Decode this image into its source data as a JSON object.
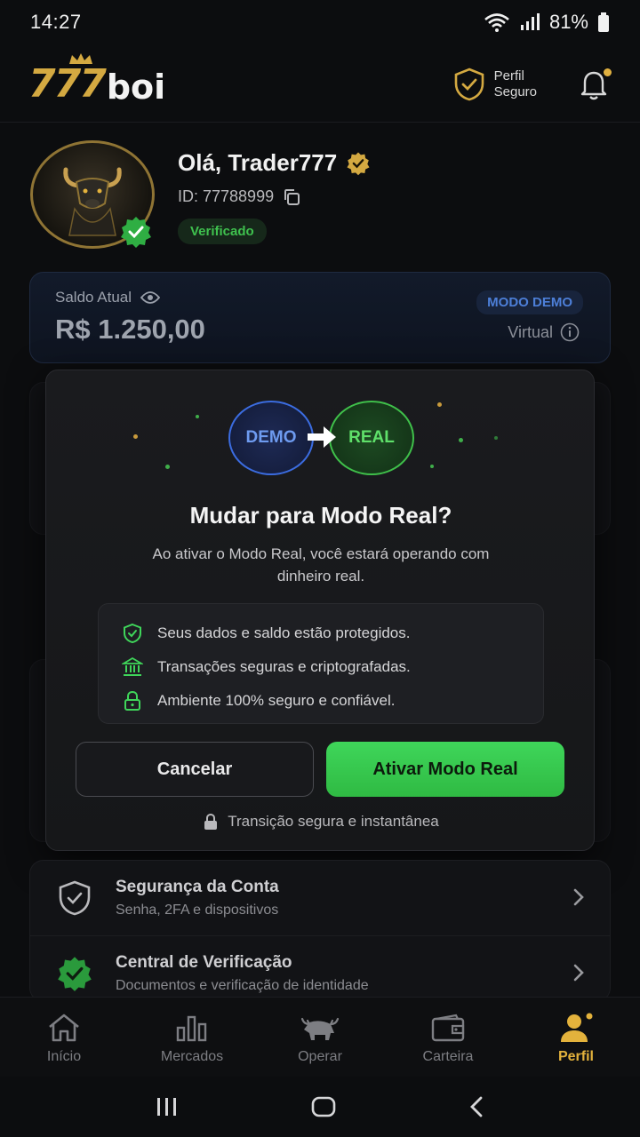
{
  "status_bar": {
    "time": "14:27",
    "battery": "81%"
  },
  "header": {
    "logo_num": "777",
    "logo_word": "boi",
    "safe_profile_line1": "Perfil",
    "safe_profile_line2": "Seguro"
  },
  "profile": {
    "greeting": "Olá, Trader777",
    "id_text": "ID: 77788999",
    "verified_label": "Verificado"
  },
  "balance": {
    "label": "Saldo Atual",
    "value": "R$ 1.250,00",
    "mode_badge": "MODO DEMO",
    "account_type": "Virtual"
  },
  "modal": {
    "demo_label": "DEMO",
    "real_label": "REAL",
    "title": "Mudar para Modo Real?",
    "description": "Ao ativar o Modo Real, você estará operando com dinheiro real.",
    "features": [
      {
        "icon": "shield-check-icon",
        "text": "Seus dados e saldo estão protegidos."
      },
      {
        "icon": "bank-icon",
        "text": "Transações seguras e criptografadas."
      },
      {
        "icon": "lock-icon",
        "text": "Ambiente 100% seguro e confiável."
      }
    ],
    "cancel_label": "Cancelar",
    "activate_label": "Ativar Modo Real",
    "secure_note": "Transição segura e instantânea"
  },
  "menu": [
    {
      "title": "Segurança da Conta",
      "subtitle": "Senha, 2FA e dispositivos"
    },
    {
      "title": "Central de Verificação",
      "subtitle": "Documentos e verificação de identidade"
    }
  ],
  "bottom_nav": [
    {
      "label": "Início"
    },
    {
      "label": "Mercados"
    },
    {
      "label": "Operar"
    },
    {
      "label": "Carteira"
    },
    {
      "label": "Perfil",
      "active": true
    }
  ],
  "colors": {
    "gold": "#e3b23c",
    "green": "#3fd65a",
    "blue": "#3b6ce0"
  }
}
